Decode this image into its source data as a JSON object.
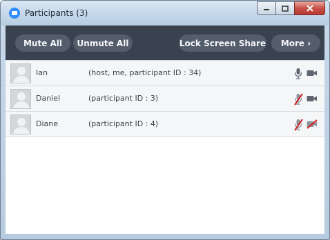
{
  "window": {
    "title": "Participants (3)",
    "controls": {
      "minimize": "–",
      "maximize": "□",
      "close": "✕"
    }
  },
  "toolbar": {
    "mute_all": "Mute All",
    "unmute_all": "Unmute All",
    "lock_screen_share": "Lock Screen Share",
    "more": "More ›"
  },
  "participants": [
    {
      "name": "Ian",
      "info": "(host, me, participant ID : 34)",
      "mic": "mic-on-icon",
      "video": "video-on-icon"
    },
    {
      "name": "Daniel",
      "info": "(participant ID : 3)",
      "mic": "mic-muted-icon",
      "video": "video-on-icon"
    },
    {
      "name": "Diane",
      "info": "(participant ID : 4)",
      "mic": "mic-muted-icon",
      "video": "video-off-icon"
    }
  ],
  "colors": {
    "toolbar_bg": "#3a4250",
    "button_bg": "#545d6c",
    "muted_red": "#d21f1f",
    "icon_gray": "#5f6670",
    "accent": "#2d8cff"
  }
}
